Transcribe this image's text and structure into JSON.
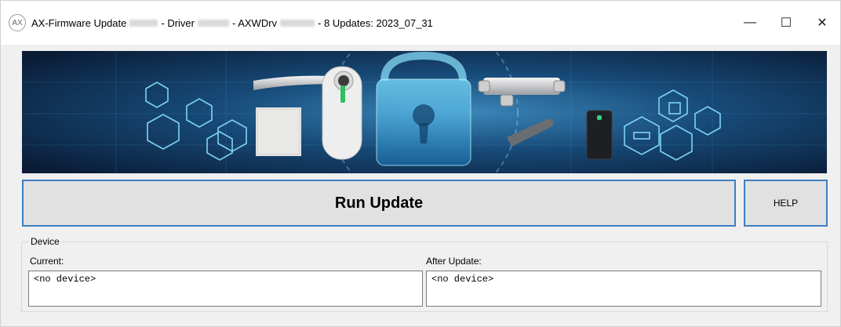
{
  "titlebar": {
    "icon_text": "AX",
    "title_part1": "AX-Firmware Update",
    "title_part2": "- Driver",
    "title_part3": "- AXWDrv",
    "title_part4": "-  8 Updates:  2023_07_31",
    "minimize_symbol": "—",
    "maximize_symbol": "☐",
    "close_symbol": "✕"
  },
  "banner": {
    "theme": "access-control devices with padlock",
    "colors": {
      "dark": "#0b1e3a",
      "glow": "#38c5ff"
    }
  },
  "actions": {
    "run_label": "Run Update",
    "help_label": "HELP"
  },
  "device": {
    "group_title": "Device",
    "current_label": "Current:",
    "current_value": "<no device>",
    "after_label": "After Update:",
    "after_value": "<no device>"
  },
  "colors": {
    "accent_border": "#3d7fc1",
    "window_bg": "#f0f0f0"
  }
}
